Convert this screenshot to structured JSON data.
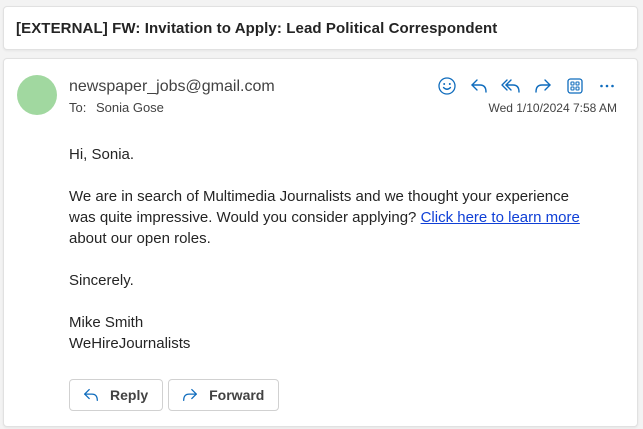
{
  "subject": "[EXTERNAL] FW: Invitation to Apply: Lead Political Correspondent",
  "message": {
    "sender": "newspaper_jobs@gmail.com",
    "to_label": "To:",
    "to_name": "Sonia Gose",
    "timestamp": "Wed 1/10/2024 7:58 AM",
    "avatar_color": "#a1d8a0",
    "greeting": "Hi, Sonia.",
    "paragraph_before_link": "We are in search of Multimedia Journalists and we thought your experience was quite impressive. Would you consider applying? ",
    "link_text": "Click here to learn more",
    "paragraph_after_link": " about our open roles.",
    "closing": "Sincerely.",
    "signature_name": "Mike Smith",
    "signature_company": "WeHireJournalists"
  },
  "toolbar": {
    "icons": [
      "emoji-icon",
      "reply-icon",
      "reply-all-icon",
      "forward-icon",
      "apps-icon",
      "more-icon"
    ],
    "accent_color": "#0f6cbd"
  },
  "actions": {
    "reply_label": "Reply",
    "forward_label": "Forward"
  }
}
